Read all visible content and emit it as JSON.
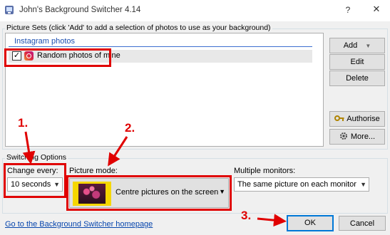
{
  "window": {
    "title": "John's Background Switcher 4.14",
    "help_glyph": "?",
    "close_glyph": "✕"
  },
  "picture_sets": {
    "group_title": "Picture Sets (click 'Add' to add a selection of photos to use as your background)",
    "list_header": "Instagram photos",
    "items": [
      {
        "label": "Random photos of mine",
        "checked": true,
        "icon": "instagram-icon"
      }
    ]
  },
  "buttons": {
    "add": "Add",
    "edit": "Edit",
    "delete": "Delete",
    "authorise": "Authorise",
    "more": "More...",
    "ok": "OK",
    "cancel": "Cancel"
  },
  "switching": {
    "group_title": "Switching Options",
    "change_every_label": "Change every:",
    "change_every_value": "10 seconds",
    "picture_mode_label": "Picture mode:",
    "picture_mode_value": "Centre pictures on the screen",
    "monitors_label": "Multiple monitors:",
    "monitors_value": "The same picture on each monitor"
  },
  "footer": {
    "homepage_link": "Go to the Background Switcher homepage"
  },
  "annotations": {
    "step1": "1.",
    "step2": "2.",
    "step3": "3.",
    "color": "#e00000"
  }
}
